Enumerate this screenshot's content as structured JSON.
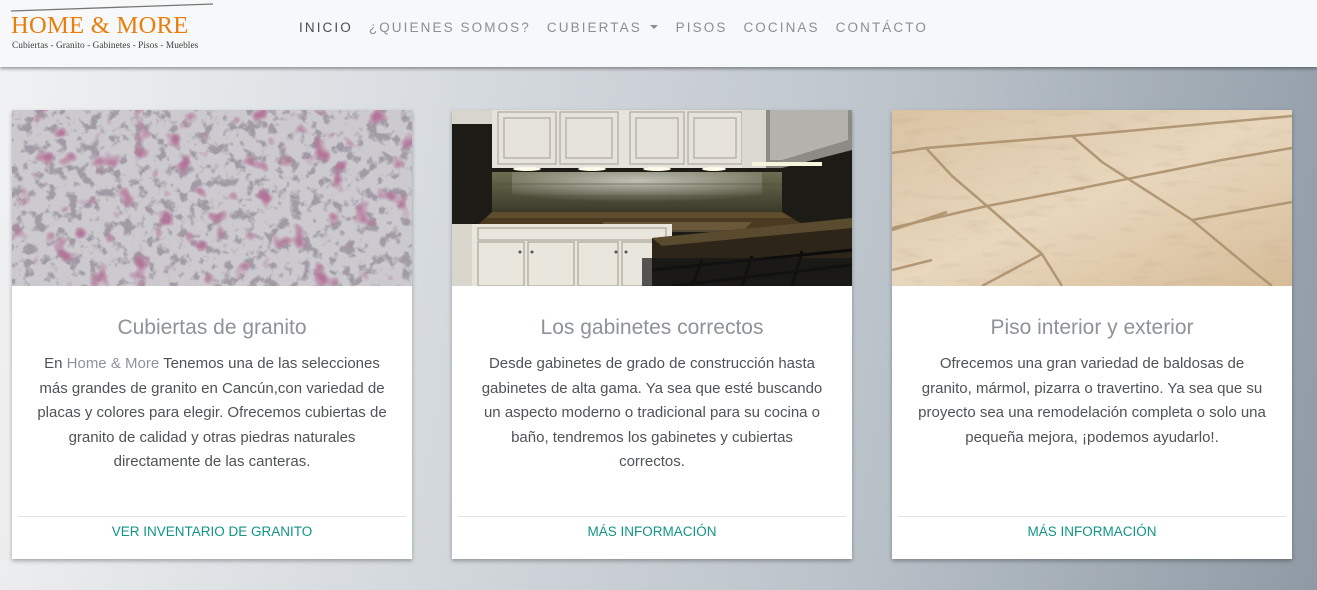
{
  "brand": {
    "name": "HOME & MORE",
    "tagline": "Cubiertas - Granito - Gabinetes - Pisos - Muebles",
    "color": "#e87e0b"
  },
  "nav": {
    "items": [
      {
        "label": "INICIO"
      },
      {
        "label": "¿QUIENES SOMOS?"
      },
      {
        "label": "CUBIERTAS"
      },
      {
        "label": "PISOS"
      },
      {
        "label": "COCINAS"
      },
      {
        "label": "CONTÁCTO"
      }
    ],
    "active": "INICIO"
  },
  "cards": [
    {
      "image": "granite-slab",
      "title": "Cubiertas de granito",
      "text_prefix": "En ",
      "text_highlight": "Home & More",
      "text": " Tenemos una de las selecciones más grandes de granito en Cancún,con variedad de placas y colores para elegir. Ofrecemos cubiertas de granito de calidad y otras piedras naturales directamente de las canteras.",
      "link": "VER INVENTARIO DE GRANITO"
    },
    {
      "image": "kitchen-cabinets",
      "title": "Los gabinetes correctos",
      "text": "Desde gabinetes de grado de construcción hasta gabinetes de alta gama. Ya sea que esté buscando un aspecto moderno o tradicional para su cocina o baño, tendremos los gabinetes y cubiertas correctos.",
      "link": "MÁS INFORMACIÓN"
    },
    {
      "image": "travertine-floor",
      "title": "Piso interior y exterior",
      "text": "Ofrecemos una gran variedad de baldosas de granito, mármol, pizarra o travertino. Ya sea que su proyecto sea una remodelación completa o solo una pequeña mejora, ¡podemos ayudarlo!.",
      "link": "MÁS INFORMACIÓN"
    }
  ],
  "colors": {
    "link": "#119484",
    "title": "#8e939a",
    "body_text": "#4f5257"
  }
}
